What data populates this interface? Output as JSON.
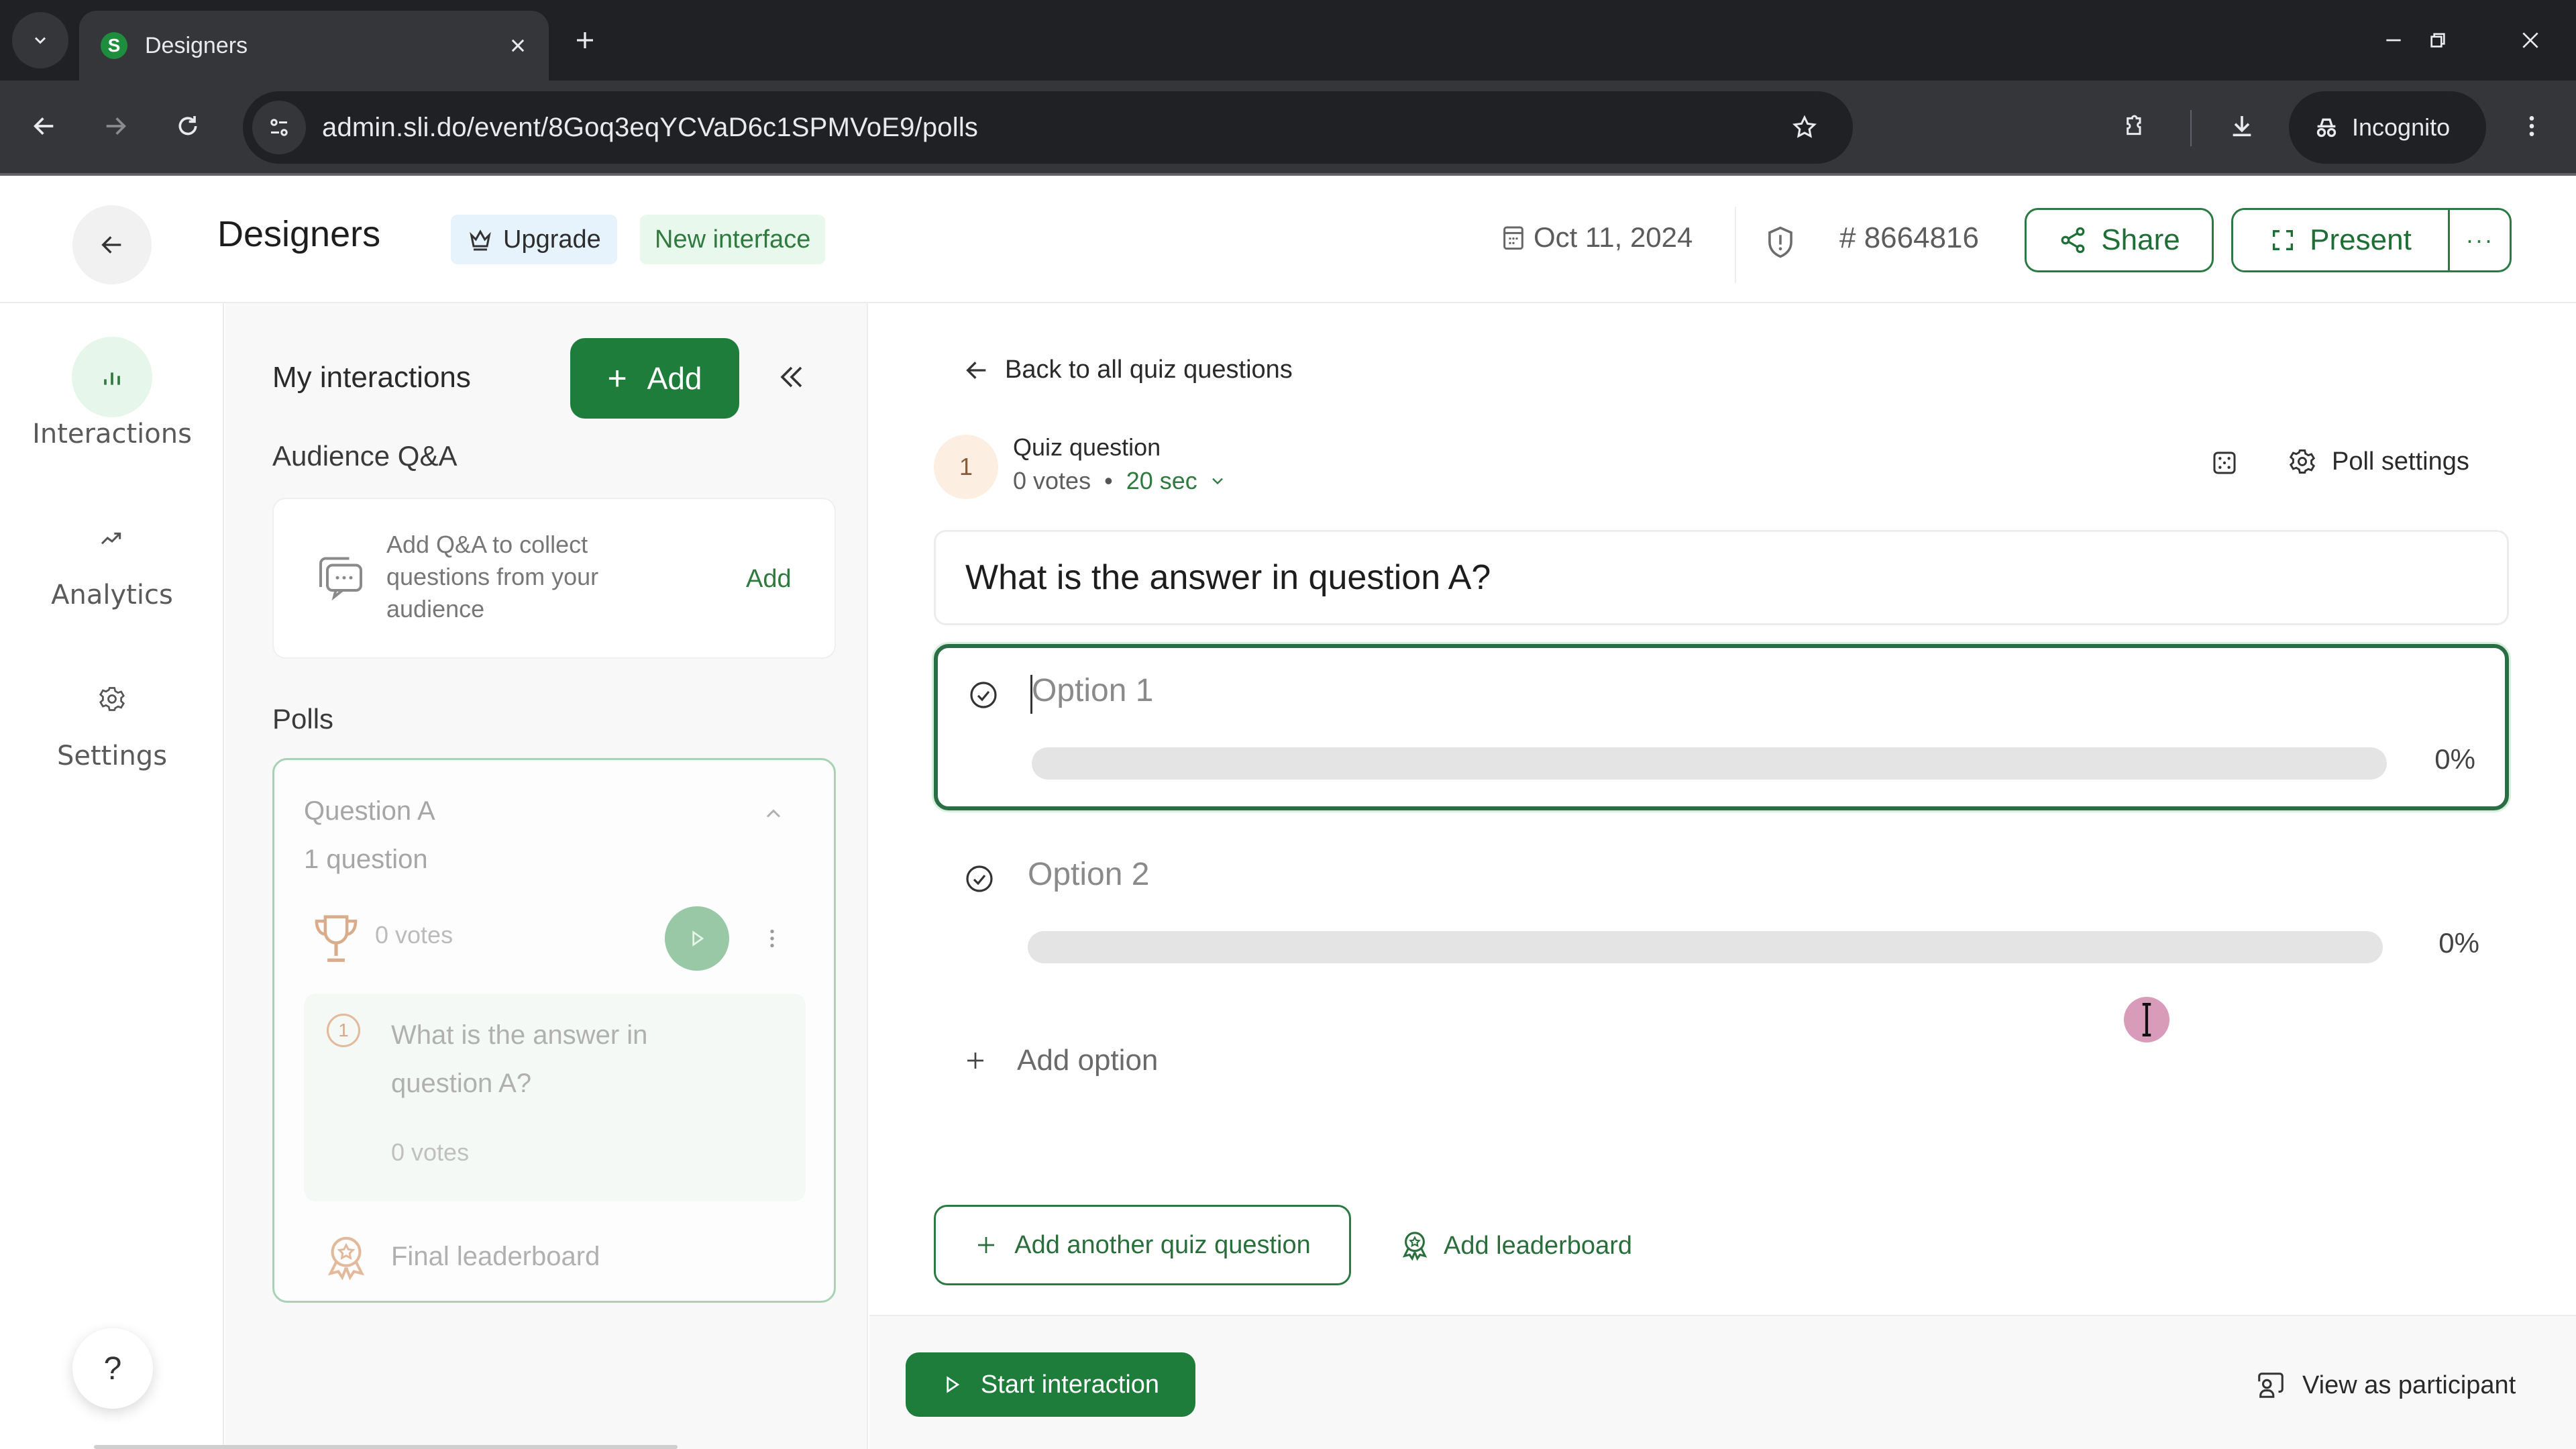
{
  "browser": {
    "tab_title": "Designers",
    "favicon_letter": "S",
    "url": "admin.sli.do/event/8Goq3eqYCVaD6c1SPMVoE9/polls",
    "profile_label": "Incognito"
  },
  "header": {
    "event_title": "Designers",
    "upgrade_label": "Upgrade",
    "new_interface_label": "New interface",
    "date": "Oct 11, 2024",
    "event_code": "# 8664816",
    "share_label": "Share",
    "present_label": "Present",
    "more_label": "···"
  },
  "rail": {
    "items": [
      {
        "label": "Interactions",
        "icon": "bar-chart-icon",
        "active": true
      },
      {
        "label": "Analytics",
        "icon": "trend-icon",
        "active": false
      },
      {
        "label": "Settings",
        "icon": "gear-icon",
        "active": false
      }
    ],
    "help_label": "?"
  },
  "panel": {
    "title": "My interactions",
    "add_label": "Add",
    "qa_section_title": "Audience Q&A",
    "qa_card_text": "Add Q&A to collect questions from your audience",
    "qa_card_add": "Add",
    "polls_section_title": "Polls",
    "poll": {
      "title": "Question A",
      "subtitle": "1 question",
      "votes": "0 votes",
      "question_number": "1",
      "question_text": "What is the answer in question A?",
      "question_votes": "0 votes",
      "leaderboard_label": "Final leaderboard"
    }
  },
  "editor": {
    "back_label": "Back to all quiz questions",
    "question_index": "1",
    "question_type": "Quiz question",
    "votes": "0 votes",
    "separator": "•",
    "timer": "20 sec",
    "poll_settings_label": "Poll settings",
    "question_text": "What is the answer in question A?",
    "options": [
      {
        "placeholder": "Option 1",
        "percent_label": "0%",
        "percent": 0,
        "focused": true
      },
      {
        "placeholder": "Option 2",
        "percent_label": "0%",
        "percent": 0,
        "focused": false
      }
    ],
    "add_option_label": "Add option",
    "add_quiz_question_label": "Add another quiz question",
    "add_leaderboard_label": "Add leaderboard",
    "start_label": "Start interaction",
    "view_participant_label": "View as participant"
  },
  "colors": {
    "brand_green": "#1e7d3a",
    "focus_border": "#2b6e45",
    "bar_track": "#e4e4e4"
  }
}
